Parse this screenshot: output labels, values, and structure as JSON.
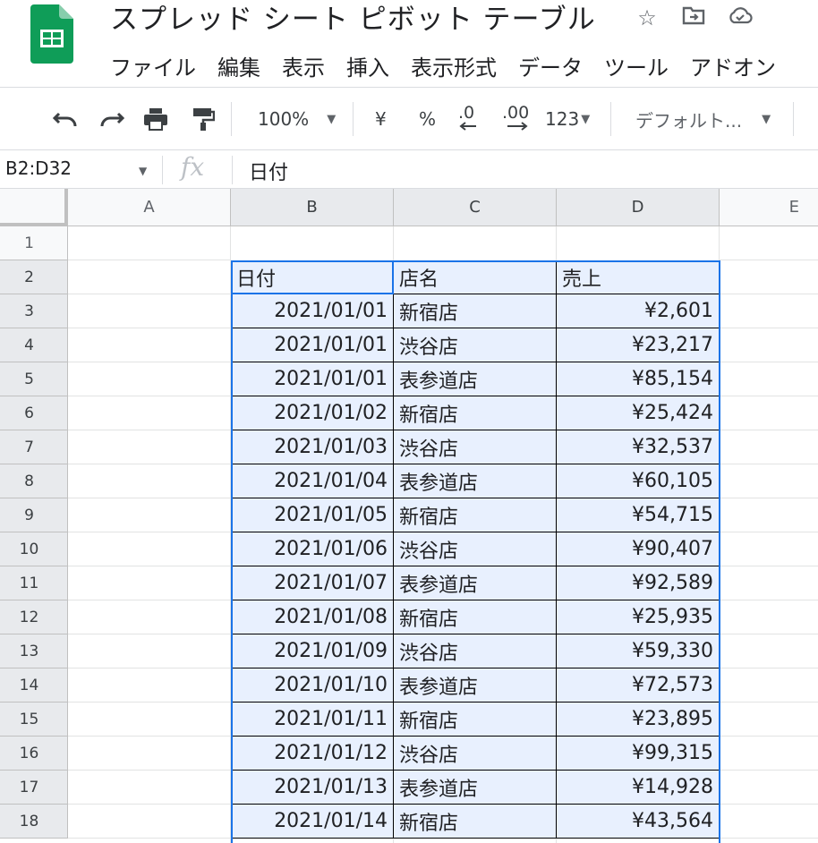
{
  "app": {
    "title": "スプレッド シート ピボット テーブル",
    "menu": [
      "ファイル",
      "編集",
      "表示",
      "挿入",
      "表示形式",
      "データ",
      "ツール",
      "アドオン"
    ]
  },
  "toolbar": {
    "zoom": "100%",
    "currency": "¥",
    "percent": "%",
    "dec_decrease": ".0",
    "dec_increase": ".00",
    "number_format": "123",
    "font": "デフォルト..."
  },
  "formula_bar": {
    "name_box": "B2:D32",
    "fx": "fx",
    "value": "日付"
  },
  "columns": [
    "A",
    "B",
    "C",
    "D",
    "E"
  ],
  "rows": [
    "1",
    "2",
    "3",
    "4",
    "5",
    "6",
    "7",
    "8",
    "9",
    "10",
    "11",
    "12",
    "13",
    "14",
    "15",
    "16",
    "17",
    "18"
  ],
  "table": {
    "header": [
      "日付",
      "店名",
      "売上"
    ],
    "records": [
      [
        "2021/01/01",
        "新宿店",
        "¥2,601"
      ],
      [
        "2021/01/01",
        "渋谷店",
        "¥23,217"
      ],
      [
        "2021/01/01",
        "表参道店",
        "¥85,154"
      ],
      [
        "2021/01/02",
        "新宿店",
        "¥25,424"
      ],
      [
        "2021/01/03",
        "渋谷店",
        "¥32,537"
      ],
      [
        "2021/01/04",
        "表参道店",
        "¥60,105"
      ],
      [
        "2021/01/05",
        "新宿店",
        "¥54,715"
      ],
      [
        "2021/01/06",
        "渋谷店",
        "¥90,407"
      ],
      [
        "2021/01/07",
        "表参道店",
        "¥92,589"
      ],
      [
        "2021/01/08",
        "新宿店",
        "¥25,935"
      ],
      [
        "2021/01/09",
        "渋谷店",
        "¥59,330"
      ],
      [
        "2021/01/10",
        "表参道店",
        "¥72,573"
      ],
      [
        "2021/01/11",
        "新宿店",
        "¥23,895"
      ],
      [
        "2021/01/12",
        "渋谷店",
        "¥99,315"
      ],
      [
        "2021/01/13",
        "表参道店",
        "¥14,928"
      ],
      [
        "2021/01/14",
        "新宿店",
        "¥43,564"
      ]
    ]
  },
  "colors": {
    "brand": "#0f9d58",
    "selection": "#1a73e8",
    "selection_fill": "#e8f0fe"
  }
}
